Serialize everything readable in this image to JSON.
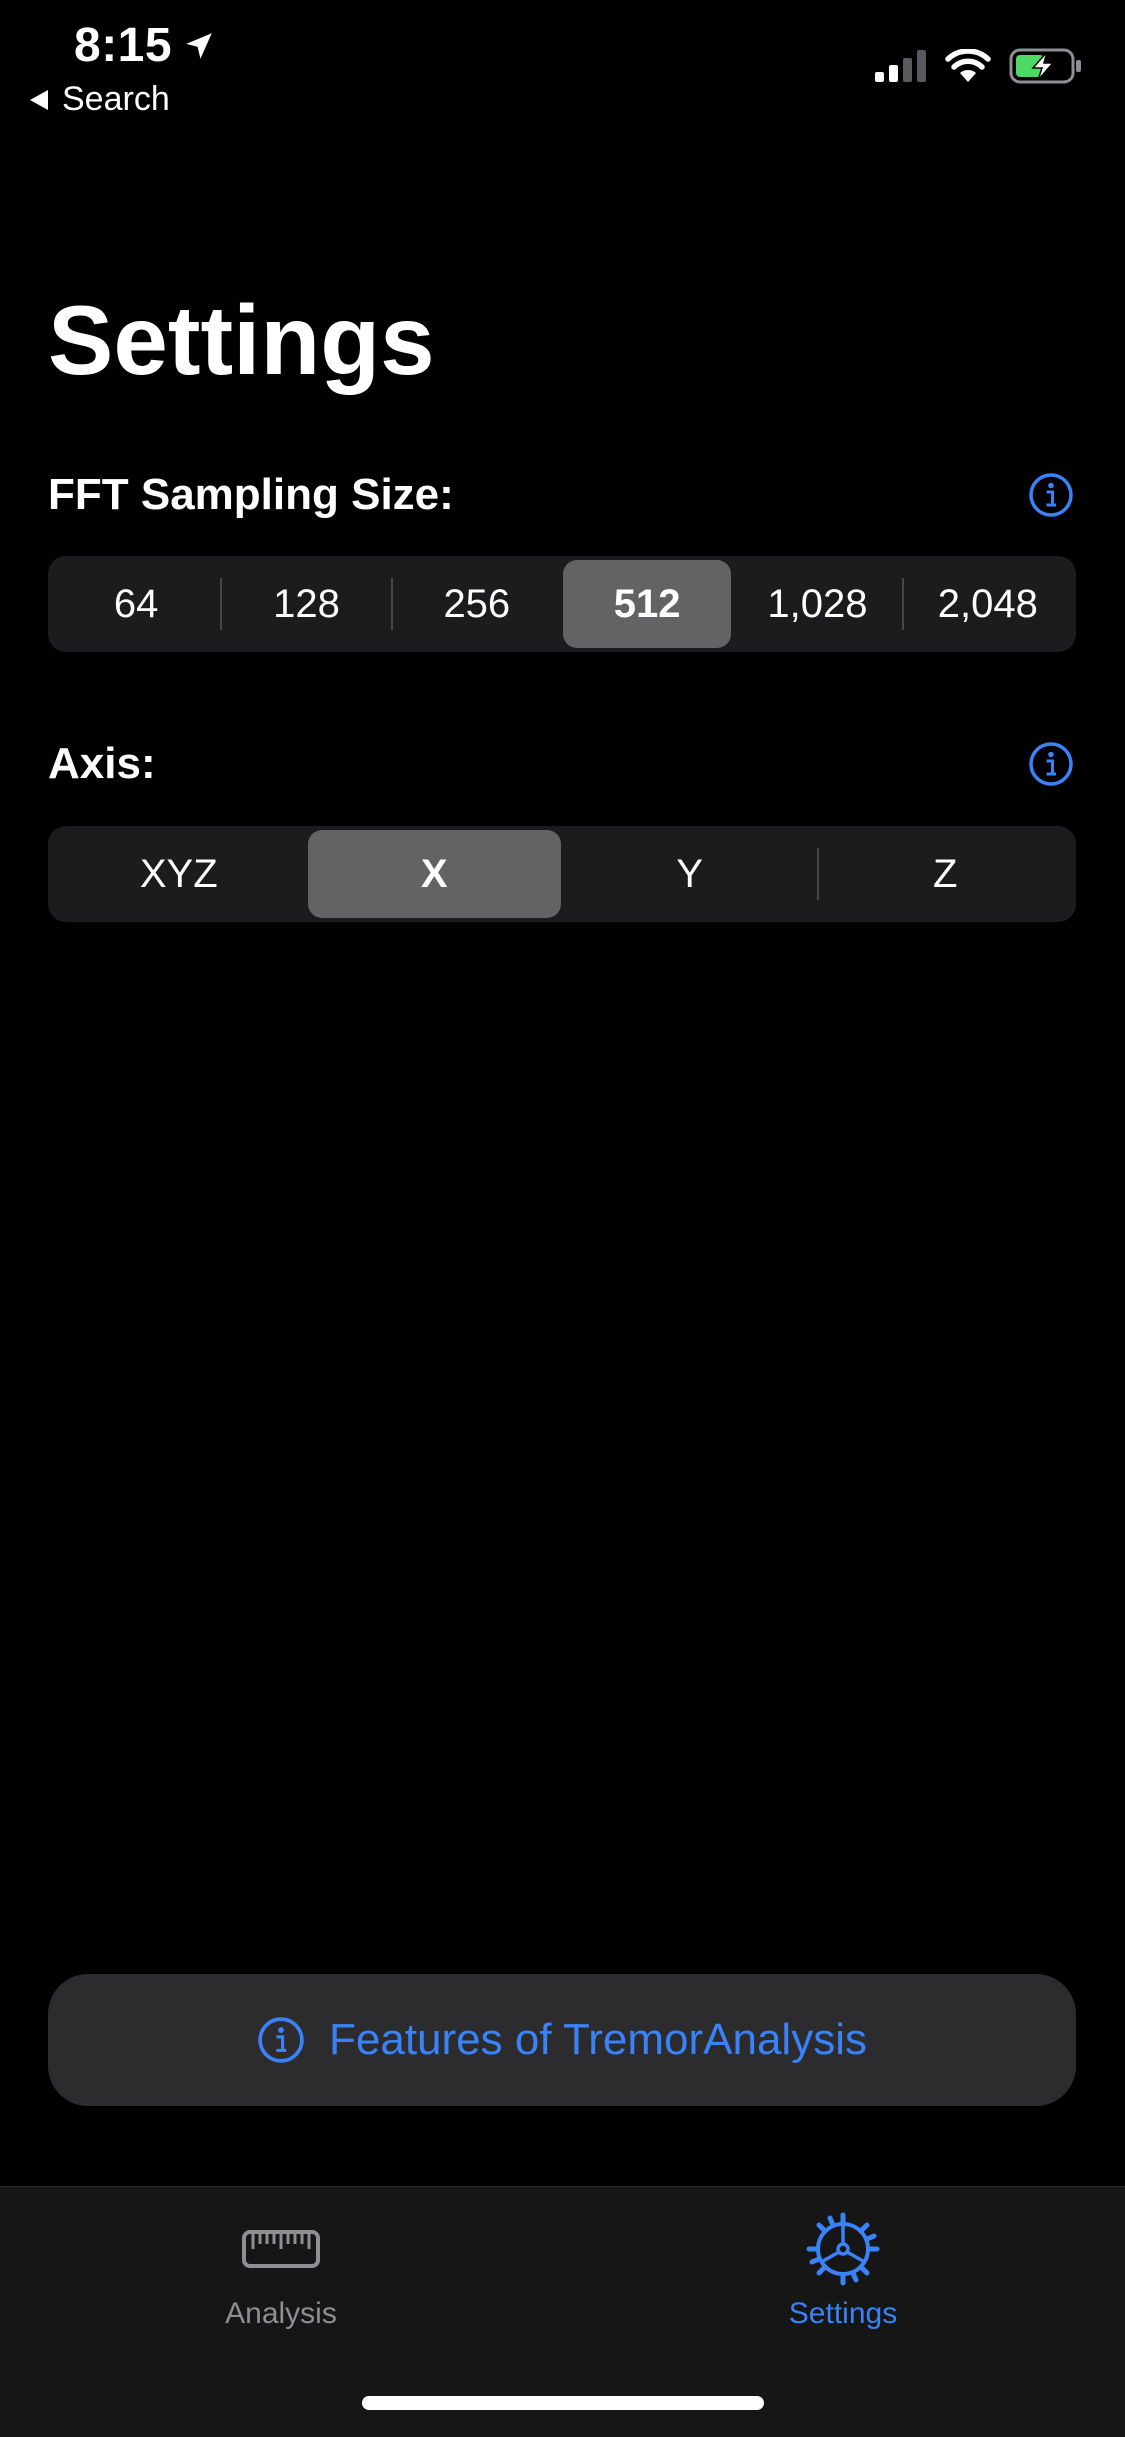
{
  "status_bar": {
    "time": "8:15",
    "back_label": "Search",
    "icons": [
      "location-arrow-icon",
      "signal-icon",
      "wifi-icon",
      "battery-charging-icon"
    ]
  },
  "page": {
    "title": "Settings"
  },
  "fft_section": {
    "label": "FFT Sampling Size:",
    "options": [
      "64",
      "128",
      "256",
      "512",
      "1,028",
      "2,048"
    ],
    "selected": "512"
  },
  "axis_section": {
    "label": "Axis:",
    "options": [
      "XYZ",
      "X",
      "Y",
      "Z"
    ],
    "selected": "X"
  },
  "features_button": {
    "label": "Features of TremorAnalysis",
    "icon": "info-circle-icon"
  },
  "tab_bar": {
    "tabs": [
      {
        "label": "Analysis",
        "icon": "ruler-icon",
        "active": false
      },
      {
        "label": "Settings",
        "icon": "gear-icon",
        "active": true
      }
    ]
  },
  "colors": {
    "accent": "#3a82f7",
    "background": "#000000",
    "segment_bg": "#1c1c1e",
    "segment_selected": "#636366",
    "battery_charge": "#4cd964",
    "inactive_tab": "#8e8e93"
  }
}
